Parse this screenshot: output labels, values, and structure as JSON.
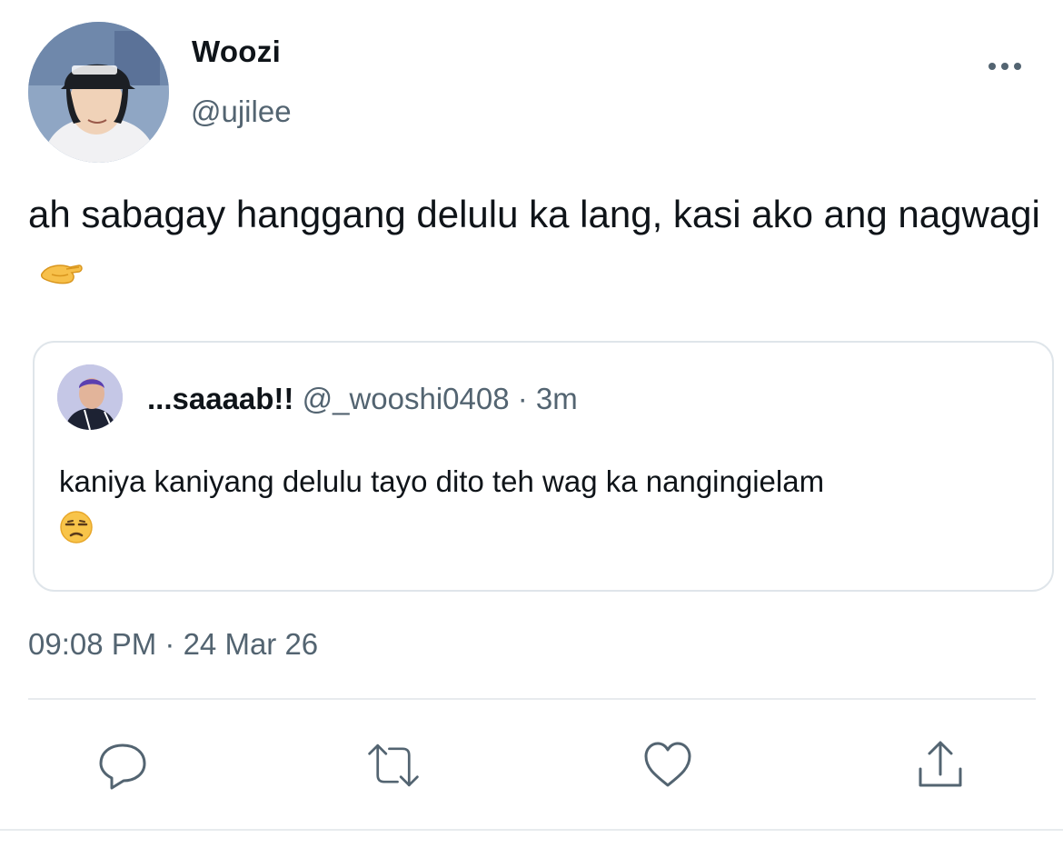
{
  "tweet": {
    "author": {
      "display_name": "Woozi",
      "handle": "@ujilee",
      "avatar_icon": "profile-photo"
    },
    "text": "ah sabagay hanggang delulu ka lang, kasi ako ang nagwagi",
    "text_emoji": "pinching-hand-emoji",
    "timestamp": "09:08 PM · 24 Mar 26",
    "more_icon": "more-horizontal-icon"
  },
  "quote": {
    "display_name": "...saaaab!!",
    "handle": "@_wooshi0408",
    "separator": " · ",
    "time": "3m",
    "text": "kaniya kaniyang delulu tayo dito teh wag ka nangingielam",
    "text_emoji": "unamused-face-emoji"
  },
  "actions": [
    {
      "name": "reply",
      "icon": "comment-icon"
    },
    {
      "name": "retweet",
      "icon": "retweet-icon"
    },
    {
      "name": "like",
      "icon": "heart-icon"
    },
    {
      "name": "share",
      "icon": "share-icon"
    }
  ],
  "colors": {
    "text_primary": "#0f1419",
    "text_secondary": "#536471",
    "border": "#dfe5ea"
  }
}
